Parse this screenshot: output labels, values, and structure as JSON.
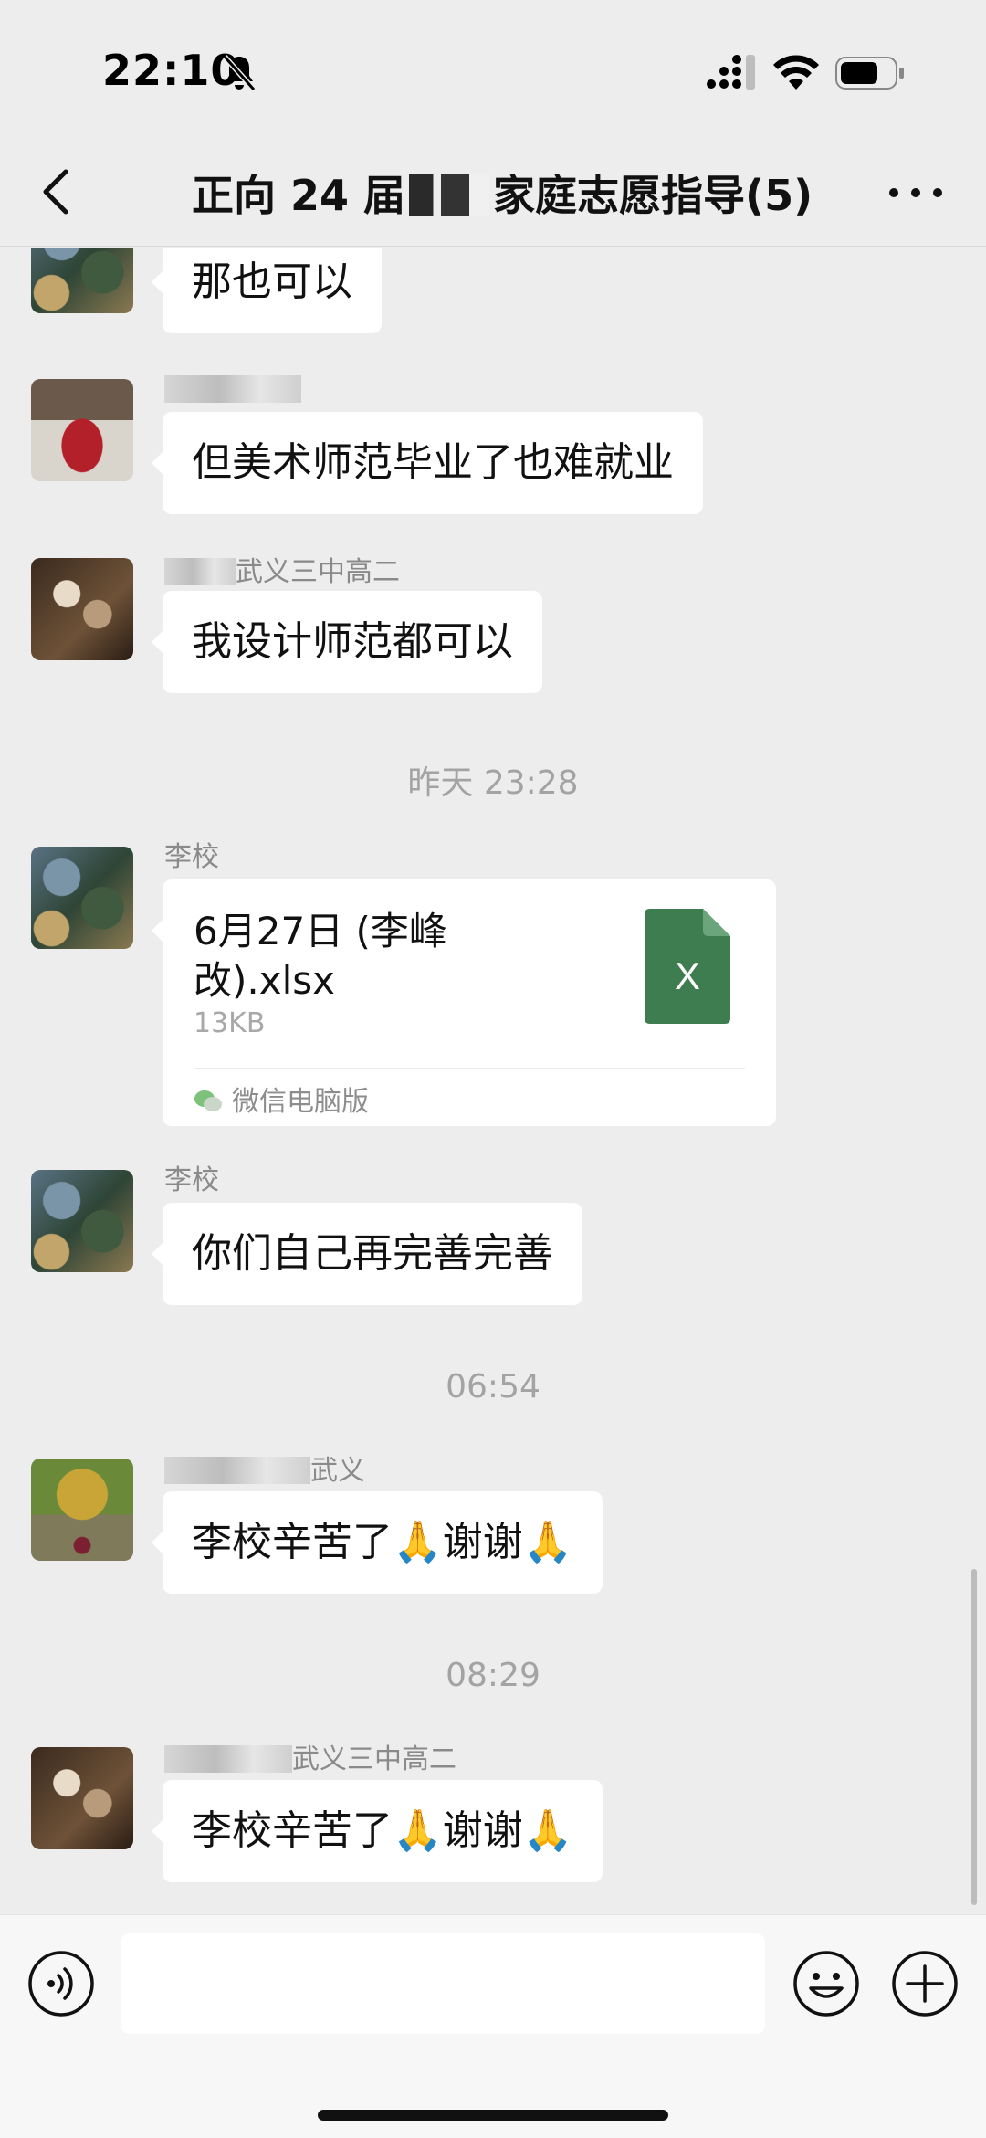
{
  "status_bar": {
    "time": "22:10"
  },
  "nav": {
    "title_prefix": "正向 24 届",
    "title_suffix": "家庭志愿指导(5)"
  },
  "messages": [
    {
      "text": "那也可以"
    },
    {
      "sender": "",
      "text": "但美术师范毕业了也难就业"
    },
    {
      "sender": "武义三中高二",
      "text": "我设计师范都可以"
    },
    {
      "timestamp": "昨天 23:28"
    },
    {
      "sender": "李校",
      "file": {
        "name": "6月27日 (李峰改).xlsx",
        "size": "13KB",
        "source": "微信电脑版",
        "icon_label": "X"
      }
    },
    {
      "sender": "李校",
      "text": "你们自己再完善完善"
    },
    {
      "timestamp": "06:54"
    },
    {
      "sender": "武义",
      "text": "李校辛苦了",
      "emoji_1": "🙏",
      "text_2": "谢谢",
      "emoji_2": "🙏"
    },
    {
      "timestamp": "08:29"
    },
    {
      "sender": "武义三中高二",
      "text": "李校辛苦了",
      "emoji_1": "🙏",
      "text_2": "谢谢",
      "emoji_2": "🙏"
    }
  ],
  "input": {
    "placeholder": ""
  },
  "icons": {
    "back": "chevron-left-icon",
    "more": "more-dots-icon",
    "voice": "voice-icon",
    "emoji": "emoji-icon",
    "plus": "plus-icon"
  },
  "colors": {
    "background": "#ededed",
    "bubble": "#ffffff",
    "excel_green": "#3d7d4f"
  }
}
